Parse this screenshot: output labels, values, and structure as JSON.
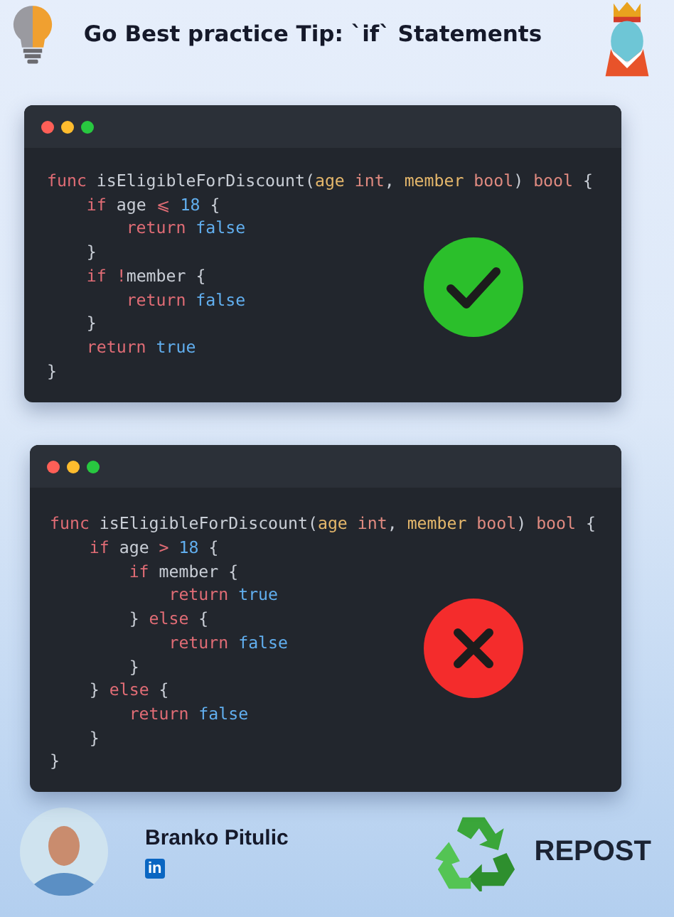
{
  "header": {
    "title": "Go Best practice Tip: `if` Statements"
  },
  "code_windows": [
    {
      "approved": true,
      "lines": [
        {
          "tokens": [
            {
              "kind": "keyword",
              "text": "func"
            },
            {
              "kind": "plain",
              "text": " isEligibleForDiscount("
            },
            {
              "kind": "param",
              "text": "age"
            },
            {
              "kind": "type",
              "text": " int"
            },
            {
              "kind": "plain",
              "text": ", "
            },
            {
              "kind": "param",
              "text": "member"
            },
            {
              "kind": "type",
              "text": " bool"
            },
            {
              "kind": "plain",
              "text": ") "
            },
            {
              "kind": "type",
              "text": "bool"
            },
            {
              "kind": "plain",
              "text": " {"
            }
          ],
          "children": [
            {
              "tokens": [
                {
                  "kind": "keyword",
                  "text": "if"
                },
                {
                  "kind": "plain",
                  "text": " age "
                },
                {
                  "kind": "keyword",
                  "text": "⩽"
                },
                {
                  "kind": "number",
                  "text": " 18"
                },
                {
                  "kind": "plain",
                  "text": " {"
                }
              ],
              "children": [
                {
                  "tokens": [
                    {
                      "kind": "keyword",
                      "text": "return"
                    },
                    {
                      "kind": "literal",
                      "text": " false"
                    }
                  ]
                }
              ]
            },
            {
              "tokens": [
                {
                  "kind": "plain",
                  "text": "}"
                }
              ]
            },
            {
              "tokens": [
                {
                  "kind": "keyword",
                  "text": "if"
                },
                {
                  "kind": "keyword",
                  "text": " !"
                },
                {
                  "kind": "plain",
                  "text": "member {"
                }
              ],
              "children": [
                {
                  "tokens": [
                    {
                      "kind": "keyword",
                      "text": "return"
                    },
                    {
                      "kind": "literal",
                      "text": " false"
                    }
                  ]
                }
              ]
            },
            {
              "tokens": [
                {
                  "kind": "plain",
                  "text": "}"
                }
              ]
            },
            {
              "tokens": [
                {
                  "kind": "keyword",
                  "text": "return"
                },
                {
                  "kind": "literal",
                  "text": " true"
                }
              ]
            }
          ]
        },
        {
          "tokens": [
            {
              "kind": "plain",
              "text": "}"
            }
          ]
        }
      ]
    },
    {
      "approved": false,
      "lines": [
        {
          "tokens": [
            {
              "kind": "keyword",
              "text": "func"
            },
            {
              "kind": "plain",
              "text": " isEligibleForDiscount("
            },
            {
              "kind": "param",
              "text": "age"
            },
            {
              "kind": "type",
              "text": " int"
            },
            {
              "kind": "plain",
              "text": ", "
            },
            {
              "kind": "param",
              "text": "member"
            },
            {
              "kind": "type",
              "text": " bool"
            },
            {
              "kind": "plain",
              "text": ") "
            },
            {
              "kind": "type",
              "text": "bool"
            },
            {
              "kind": "plain",
              "text": " {"
            }
          ],
          "children": [
            {
              "tokens": [
                {
                  "kind": "keyword",
                  "text": "if"
                },
                {
                  "kind": "plain",
                  "text": " age "
                },
                {
                  "kind": "keyword",
                  "text": ">"
                },
                {
                  "kind": "number",
                  "text": " 18"
                },
                {
                  "kind": "plain",
                  "text": " {"
                }
              ],
              "children": [
                {
                  "tokens": [
                    {
                      "kind": "keyword",
                      "text": "if"
                    },
                    {
                      "kind": "plain",
                      "text": " member {"
                    }
                  ],
                  "children": [
                    {
                      "tokens": [
                        {
                          "kind": "keyword",
                          "text": "return"
                        },
                        {
                          "kind": "literal",
                          "text": " true"
                        }
                      ]
                    }
                  ]
                },
                {
                  "tokens": [
                    {
                      "kind": "plain",
                      "text": "} "
                    },
                    {
                      "kind": "keyword",
                      "text": "else"
                    },
                    {
                      "kind": "plain",
                      "text": " {"
                    }
                  ],
                  "children": [
                    {
                      "tokens": [
                        {
                          "kind": "keyword",
                          "text": "return"
                        },
                        {
                          "kind": "literal",
                          "text": " false"
                        }
                      ]
                    }
                  ]
                },
                {
                  "tokens": [
                    {
                      "kind": "plain",
                      "text": "}"
                    }
                  ]
                }
              ]
            },
            {
              "tokens": [
                {
                  "kind": "plain",
                  "text": "} "
                },
                {
                  "kind": "keyword",
                  "text": "else"
                },
                {
                  "kind": "plain",
                  "text": " {"
                }
              ],
              "children": [
                {
                  "tokens": [
                    {
                      "kind": "keyword",
                      "text": "return"
                    },
                    {
                      "kind": "literal",
                      "text": " false"
                    }
                  ]
                }
              ]
            },
            {
              "tokens": [
                {
                  "kind": "plain",
                  "text": "}"
                }
              ]
            }
          ]
        },
        {
          "tokens": [
            {
              "kind": "plain",
              "text": "}"
            }
          ]
        }
      ]
    }
  ],
  "author": {
    "name": "Branko Pitulic",
    "network": "in"
  },
  "repost": {
    "label": "REPOST"
  }
}
